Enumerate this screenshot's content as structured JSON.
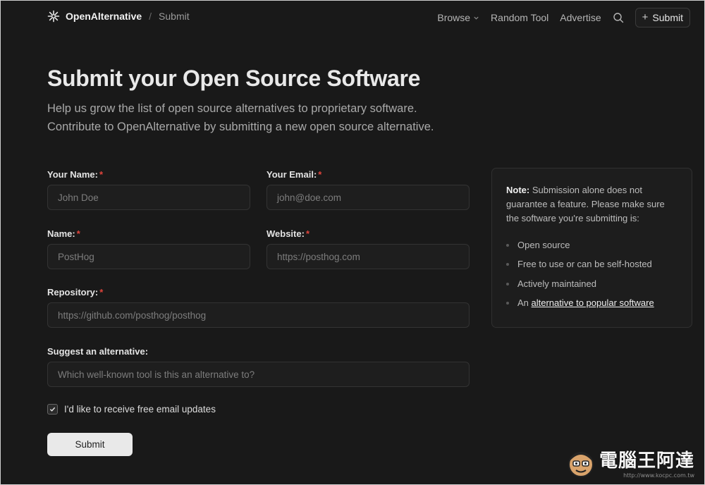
{
  "header": {
    "brand": "OpenAlternative",
    "separator": "/",
    "breadcrumb": "Submit",
    "nav": {
      "browse": "Browse",
      "random_tool": "Random Tool",
      "advertise": "Advertise",
      "submit": "Submit"
    }
  },
  "hero": {
    "title": "Submit your Open Source Software",
    "subtitle_line1": "Help us grow the list of open source alternatives to proprietary software.",
    "subtitle_line2": "Contribute to OpenAlternative by submitting a new open source alternative."
  },
  "form": {
    "your_name": {
      "label": "Your Name:",
      "placeholder": "John Doe",
      "required": "*"
    },
    "your_email": {
      "label": "Your Email:",
      "placeholder": "john@doe.com",
      "required": "*"
    },
    "name": {
      "label": "Name:",
      "placeholder": "PostHog",
      "required": "*"
    },
    "website": {
      "label": "Website:",
      "placeholder": "https://posthog.com",
      "required": "*"
    },
    "repository": {
      "label": "Repository:",
      "placeholder": "https://github.com/posthog/posthog",
      "required": "*"
    },
    "suggest": {
      "label": "Suggest an alternative:",
      "placeholder": "Which well-known tool is this an alternative to?"
    },
    "newsletter": {
      "label": "I'd like to receive free email updates",
      "checked": true
    },
    "submit_label": "Submit"
  },
  "note": {
    "bold": "Note:",
    "text": " Submission alone does not guarantee a feature. Please make sure the software you're submitting is:",
    "items": [
      "Open source",
      "Free to use or can be self-hosted",
      "Actively maintained"
    ],
    "last_item_prefix": "An ",
    "last_item_link": "alternative to popular software"
  },
  "watermark": {
    "text": "電腦王阿達",
    "url": "http://www.kocpc.com.tw"
  },
  "colors": {
    "background": "#191919",
    "required": "#e0443c",
    "button": "#e9e9e9"
  }
}
